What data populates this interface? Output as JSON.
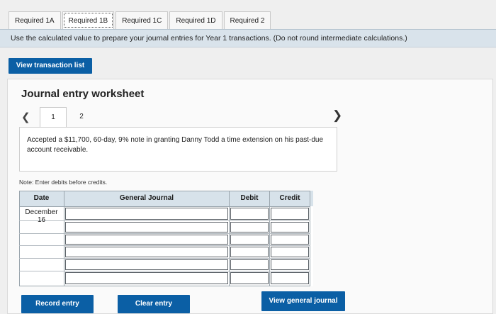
{
  "tabs": [
    "Required 1A",
    "Required 1B",
    "Required 1C",
    "Required 1D",
    "Required 2"
  ],
  "active_tab": 1,
  "instruction": "Use the calculated value to prepare your journal entries for Year 1 transactions. (Do not round intermediate calculations.)",
  "buttons": {
    "view_transactions": "View transaction list",
    "record_entry": "Record entry",
    "clear_entry": "Clear entry",
    "view_general_journal": "View general journal"
  },
  "worksheet": {
    "title": "Journal entry worksheet",
    "pages": [
      "1",
      "2"
    ],
    "active_page": 0,
    "description": "Accepted a $11,700, 60-day, 9% note in granting Danny Todd a time extension on his past-due account receivable.",
    "note": "Note: Enter debits before credits."
  },
  "journal_table": {
    "headers": {
      "date": "Date",
      "account": "General Journal",
      "debit": "Debit",
      "credit": "Credit"
    },
    "first_row_date": "December\n16",
    "row_count": 6
  },
  "colors": {
    "accent": "#0b5fa5",
    "instruction_bar": "#d9e3eb"
  }
}
